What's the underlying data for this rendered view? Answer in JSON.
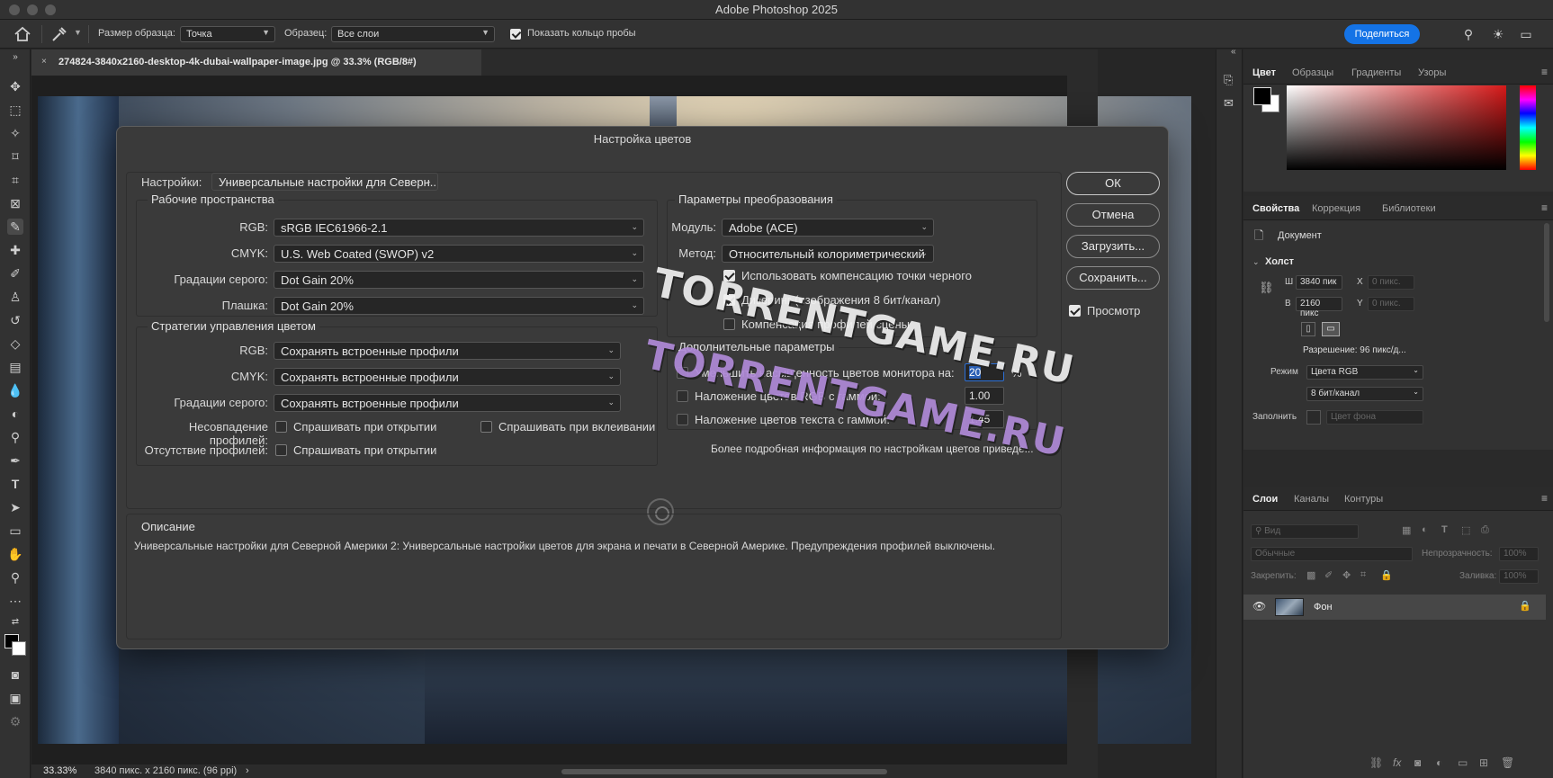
{
  "window": {
    "title": "Adobe Photoshop 2025"
  },
  "options_bar": {
    "sample_size_label": "Размер образца:",
    "sample_size_value": "Точка",
    "sample_label": "Образец:",
    "sample_value": "Все слои",
    "show_ring_label": "Показать кольцо пробы",
    "share_label": "Поделиться"
  },
  "document": {
    "tab_title": "274824-3840x2160-desktop-4k-dubai-wallpaper-image.jpg @ 33.3% (RGB/8#)",
    "close": "×"
  },
  "status": {
    "zoom": "33.33%",
    "info": "3840 пикс. x 2160 пикс. (96 ppi)",
    "arrow": "›"
  },
  "dialog": {
    "title": "Настройка цветов",
    "settings_label": "Настройки:",
    "settings_value": "Универсальные настройки для Северн...",
    "working_spaces": {
      "title": "Рабочие пространства",
      "rgb_label": "RGB:",
      "rgb_value": "sRGB IEC61966-2.1",
      "cmyk_label": "CMYK:",
      "cmyk_value": "U.S. Web Coated (SWOP) v2",
      "gray_label": "Градации серого:",
      "gray_value": "Dot Gain 20%",
      "spot_label": "Плашка:",
      "spot_value": "Dot Gain 20%"
    },
    "policies": {
      "title": "Стратегии управления цветом",
      "rgb_label": "RGB:",
      "rgb_value": "Сохранять встроенные профили",
      "cmyk_label": "CMYK:",
      "cmyk_value": "Сохранять встроенные профили",
      "gray_label": "Градации серого:",
      "gray_value": "Сохранять встроенные профили",
      "mismatch_label": "Несовпадение профилей:",
      "mismatch_open": "Спрашивать при открытии",
      "mismatch_paste": "Спрашивать при вклеивании",
      "missing_label": "Отсутствие профилей:",
      "missing_open": "Спрашивать при открытии"
    },
    "conversion": {
      "title": "Параметры преобразования",
      "engine_label": "Модуль:",
      "engine_value": "Adobe (ACE)",
      "intent_label": "Метод:",
      "intent_value": "Относительный колориметрический",
      "bpc": "Использовать компенсацию точки черного",
      "dither": "Дизеринг (изображения 8 бит/канал)",
      "scene": "Компенсация профилей сцены"
    },
    "advanced": {
      "title": "Дополнительные параметры",
      "desaturate": "Уменьшить насыщенность цветов монитора на:",
      "desaturate_value": "20",
      "percent": "%",
      "blend_rgb": "Наложение цветов RGB с гаммой:",
      "blend_rgb_value": "1.00",
      "blend_text": "Наложение цветов текста с гаммой:",
      "blend_text_value": "1.45",
      "more_info": "Более подробная информация по настройкам цветов приведе..."
    },
    "description": {
      "title": "Описание",
      "text": "Универсальные настройки для Северной Америки 2:  Универсальные настройки цветов для экрана и печати в Северной Америке. Предупреждения профилей выключены."
    },
    "buttons": {
      "ok": "ОК",
      "cancel": "Отмена",
      "load": "Загрузить...",
      "save": "Сохранить..."
    },
    "preview_label": "Просмотр"
  },
  "panels": {
    "color_tabs": [
      "Цвет",
      "Образцы",
      "Градиенты",
      "Узоры"
    ],
    "props_tabs": [
      "Свойства",
      "Коррекция",
      "Библиотеки"
    ],
    "props": {
      "doc_label": "Документ",
      "canvas_label": "Холст",
      "w_label": "Ш",
      "w_value": "3840 пик",
      "h_label": "В",
      "h_value": "2160 пикс",
      "x_label": "X",
      "x_value": "0 пикс.",
      "y_label": "Y",
      "y_value": "0 пикс.",
      "resolution": "Разрешение: 96 пикс/д...",
      "mode_label": "Режим",
      "mode_value": "Цвета RGB",
      "depth_value": "8 бит/канал",
      "fill_label": "Заполнить",
      "fill_value": "Цвет фона"
    },
    "layers_tabs": [
      "Слои",
      "Каналы",
      "Контуры"
    ],
    "layers": {
      "search_placeholder": "Вид",
      "blend_mode": "Обычные",
      "opacity_label": "Непрозрачность:",
      "opacity_value": "100%",
      "lock_label": "Закрепить:",
      "fill_label": "Заливка:",
      "fill_value": "100%",
      "layer_name": "Фон"
    }
  },
  "watermark": {
    "line1": "TORRENTGAME.RU",
    "line2": "TORRENTGAME.RU"
  },
  "colors": {
    "accent": "#1473e6",
    "panel": "#323232",
    "dialog": "#3a3a3a"
  }
}
